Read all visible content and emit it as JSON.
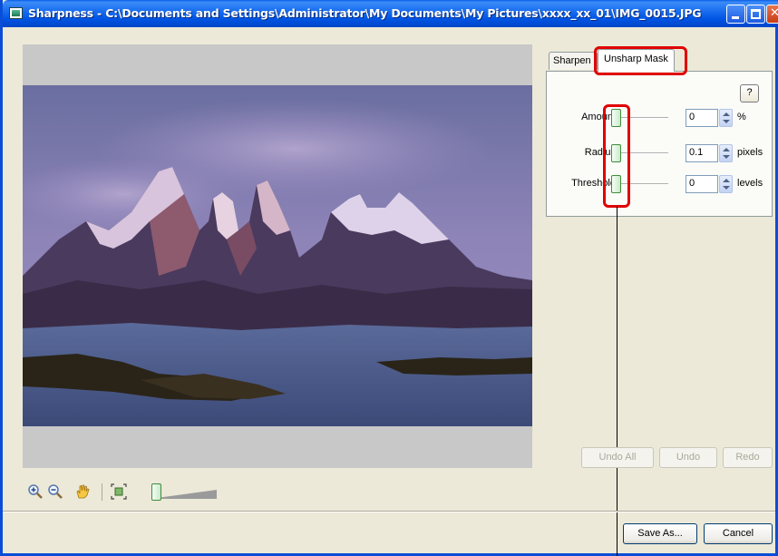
{
  "window": {
    "title": "Sharpness - C:\\Documents and Settings\\Administrator\\My Documents\\My Pictures\\xxxx_xx_01\\IMG_0015.JPG",
    "title_bar_color": "#0054e3"
  },
  "tabs": [
    {
      "label": "Sharpen",
      "selected": false
    },
    {
      "label": "Unsharp Mask",
      "selected": true
    }
  ],
  "panel": {
    "help_label": "?",
    "params": [
      {
        "label": "Amount",
        "value": "0",
        "unit": "%"
      },
      {
        "label": "Radius",
        "value": "0.1",
        "unit": "pixels"
      },
      {
        "label": "Threshold",
        "value": "0",
        "unit": "levels"
      }
    ]
  },
  "history_buttons": {
    "undo_all": "Undo All",
    "undo": "Undo",
    "redo": "Redo"
  },
  "footer": {
    "save_as": "Save As...",
    "cancel": "Cancel"
  },
  "toolbar_icons": [
    "zoom-in-icon",
    "zoom-out-icon",
    "hand-icon",
    "fit-to-window-icon"
  ],
  "highlight_color": "#e00000"
}
